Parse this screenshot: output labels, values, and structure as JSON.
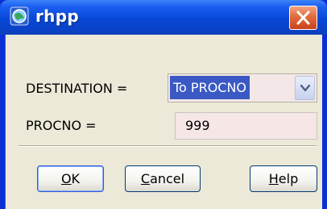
{
  "window": {
    "title": "rhpp",
    "icons": {
      "app": "globe-app-icon",
      "close": "close-x-icon",
      "dropdown": "chevron-down-icon"
    }
  },
  "form": {
    "destination_label": "DESTINATION =",
    "destination_value": "To PROCNO",
    "procno_label": "PROCNO =",
    "procno_value": "999"
  },
  "buttons": {
    "ok": {
      "mnemonic": "O",
      "rest": "K"
    },
    "cancel": {
      "mnemonic": "C",
      "rest": "ancel"
    },
    "help": {
      "mnemonic": "H",
      "rest": "elp"
    }
  },
  "colors": {
    "title_bar": "#0a48d6",
    "close_button": "#e0643a",
    "selection": "#3a59c4",
    "field_background": "#f6e6e6",
    "dialog_background": "#ece9d8"
  }
}
